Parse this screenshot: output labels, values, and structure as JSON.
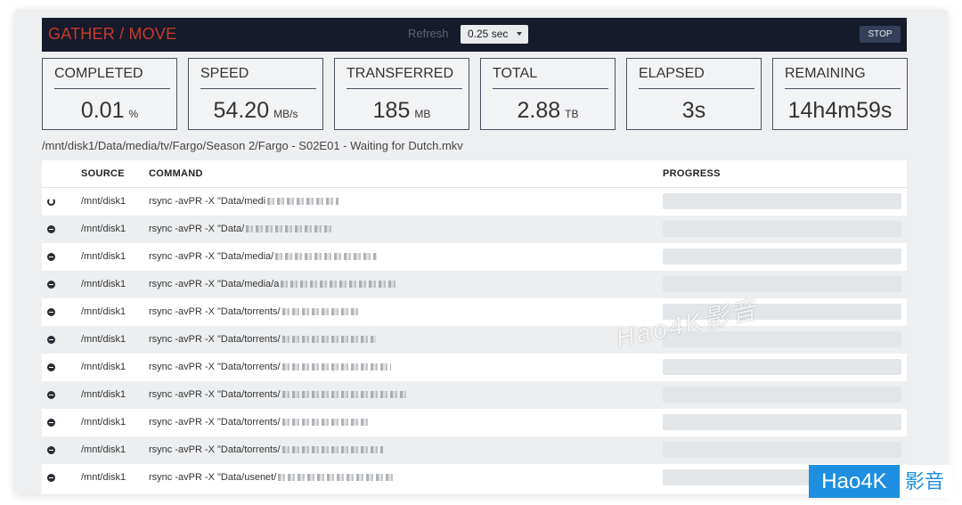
{
  "header": {
    "app_title": "GATHER / MOVE",
    "refresh_label": "Refresh",
    "refresh_selected": "0.25 sec",
    "stop_label": "STOP",
    "title_color": "#c63b2c",
    "bar_color": "#151b2b"
  },
  "stats": [
    {
      "label": "COMPLETED",
      "value": "0.01",
      "unit": "%"
    },
    {
      "label": "SPEED",
      "value": "54.20",
      "unit": "MB/s"
    },
    {
      "label": "TRANSFERRED",
      "value": "185",
      "unit": "MB"
    },
    {
      "label": "TOTAL",
      "value": "2.88",
      "unit": "TB"
    },
    {
      "label": "ELAPSED",
      "value": "3s",
      "unit": ""
    },
    {
      "label": "REMAINING",
      "value": "14h4m59s",
      "unit": ""
    }
  ],
  "current_path": "/mnt/disk1/Data/media/tv/Fargo/Season 2/Fargo - S02E01 - Waiting for Dutch.mkv",
  "table": {
    "headers": {
      "source": "SOURCE",
      "command": "COMMAND",
      "progress": "PROGRESS"
    },
    "rows": [
      {
        "status": "running",
        "status_icon": "spinner-icon",
        "source": "/mnt/disk1",
        "command": "rsync -avPR -X \"Data/medi",
        "progress": 0
      },
      {
        "status": "pending",
        "status_icon": "minus-circle-icon",
        "source": "/mnt/disk1",
        "command": "rsync -avPR -X \"Data/",
        "progress": 0
      },
      {
        "status": "pending",
        "status_icon": "minus-circle-icon",
        "source": "/mnt/disk1",
        "command": "rsync -avPR -X \"Data/media/",
        "progress": 0
      },
      {
        "status": "pending",
        "status_icon": "minus-circle-icon",
        "source": "/mnt/disk1",
        "command": "rsync -avPR -X \"Data/media/a",
        "progress": 0
      },
      {
        "status": "pending",
        "status_icon": "minus-circle-icon",
        "source": "/mnt/disk1",
        "command": "rsync -avPR -X \"Data/torrents/",
        "progress": 0
      },
      {
        "status": "pending",
        "status_icon": "minus-circle-icon",
        "source": "/mnt/disk1",
        "command": "rsync -avPR -X \"Data/torrents/",
        "progress": 0
      },
      {
        "status": "pending",
        "status_icon": "minus-circle-icon",
        "source": "/mnt/disk1",
        "command": "rsync -avPR -X \"Data/torrents/",
        "progress": 0
      },
      {
        "status": "pending",
        "status_icon": "minus-circle-icon",
        "source": "/mnt/disk1",
        "command": "rsync -avPR -X \"Data/torrents/",
        "progress": 0
      },
      {
        "status": "pending",
        "status_icon": "minus-circle-icon",
        "source": "/mnt/disk1",
        "command": "rsync -avPR -X \"Data/torrents/",
        "progress": 0
      },
      {
        "status": "pending",
        "status_icon": "minus-circle-icon",
        "source": "/mnt/disk1",
        "command": "rsync -avPR -X \"Data/torrents/",
        "progress": 0
      },
      {
        "status": "pending",
        "status_icon": "minus-circle-icon",
        "source": "/mnt/disk1",
        "command": "rsync -avPR -X \"Data/usenet/",
        "progress": 0
      }
    ]
  },
  "watermark": {
    "center_text": "Hao4K影音",
    "corner_box": "Hao4K",
    "corner_text": "影音",
    "brand_color": "#1e8fe0"
  }
}
